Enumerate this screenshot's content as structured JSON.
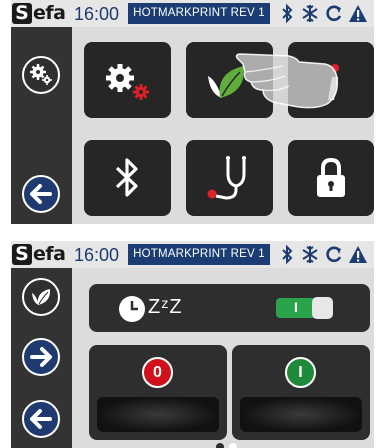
{
  "screen_1": {
    "statusbar": {
      "logo_initial": "S",
      "logo_rest": "efa",
      "time": "16:00",
      "machine_title": "HOTMARKPRINT REV 1",
      "icons": [
        "bluetooth-icon",
        "snowflake-icon",
        "refresh-icon",
        "warning-icon"
      ]
    },
    "sidebar": {
      "buttons": [
        "settings-icon",
        "back-arrow-icon"
      ]
    },
    "tiles": [
      {
        "icon": "settings-gears-icon"
      },
      {
        "icon": "eco-leaf-icon"
      },
      {
        "icon": "info-icon"
      },
      {
        "icon": "bluetooth-icon"
      },
      {
        "icon": "stethoscope-icon"
      },
      {
        "icon": "lock-icon"
      }
    ],
    "overlay": {
      "icon": "pointing-hand-icon"
    }
  },
  "screen_2": {
    "statusbar": {
      "logo_initial": "S",
      "logo_rest": "efa",
      "time": "16:00",
      "machine_title": "HOTMARKPRINT REV 1",
      "icons": [
        "bluetooth-icon",
        "snowflake-icon",
        "refresh-icon",
        "warning-icon"
      ]
    },
    "sidebar": {
      "buttons": [
        "eco-leaf-icon",
        "forward-arrow-icon",
        "back-arrow-icon"
      ]
    },
    "sleep_row": {
      "icon": "clock-icon",
      "sleep_text": "ZᶻZ",
      "toggle_label": "I",
      "toggle_state": "on"
    },
    "off_button": {
      "label": "0",
      "color": "#d0101a"
    },
    "on_button": {
      "label": "I",
      "color": "#1f8a3a"
    },
    "pagination": {
      "pages": 2,
      "current": 2
    }
  },
  "colors": {
    "navy": "#1c3d73",
    "panel": "#262626",
    "accent_red": "#e0202a",
    "leaf_green": "#5fae3c"
  }
}
